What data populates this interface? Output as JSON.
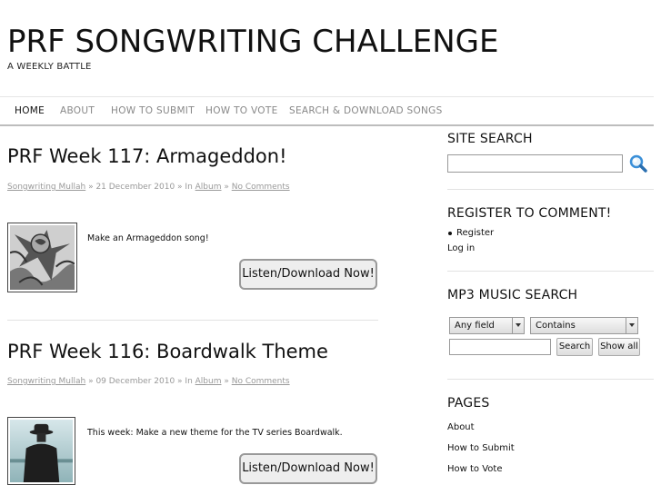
{
  "site": {
    "title": "PRF SONGWRITING CHALLENGE",
    "tagline": "A WEEKLY BATTLE"
  },
  "nav": {
    "items": [
      {
        "label": "HOME",
        "active": true
      },
      {
        "label": "ABOUT",
        "active": false
      },
      {
        "label": "HOW TO SUBMIT",
        "active": false
      },
      {
        "label": "HOW TO VOTE",
        "active": false
      },
      {
        "label": "SEARCH & DOWNLOAD SONGS",
        "active": false
      }
    ]
  },
  "posts": [
    {
      "title": "PRF Week 117: Armageddon!",
      "author": "Songwriting Mullah",
      "sep1": " » ",
      "date": "21 December 2010",
      "sep2": " » In ",
      "category": "Album",
      "sep3": " » ",
      "comments": "No Comments",
      "excerpt": "Make an Armageddon song!",
      "button": "Listen/Download Now!"
    },
    {
      "title": "PRF Week 116: Boardwalk Theme",
      "author": "Songwriting Mullah",
      "sep1": " » ",
      "date": "09 December 2010",
      "sep2": " » In ",
      "category": "Album",
      "sep3": " » ",
      "comments": "No Comments",
      "excerpt": "This week: Make a new theme for the TV series Boardwalk.",
      "button": "Listen/Download Now!"
    }
  ],
  "sidebar": {
    "site_search": {
      "heading": "SITE SEARCH",
      "icon": "magnifier-icon"
    },
    "register": {
      "heading": "REGISTER TO COMMENT!",
      "register_link": "Register",
      "login_link": "Log in"
    },
    "mp3": {
      "heading": "MP3 MUSIC SEARCH",
      "field_select": "Any field",
      "match_select": "Contains",
      "search_button": "Search",
      "show_all_button": "Show all"
    },
    "pages": {
      "heading": "PAGES",
      "links": [
        "About",
        "How to Submit",
        "How to Vote"
      ]
    }
  },
  "colors": {
    "text": "#111111",
    "muted": "#999999",
    "nav_muted": "#888888",
    "search_icon": "#3a8fd8"
  }
}
